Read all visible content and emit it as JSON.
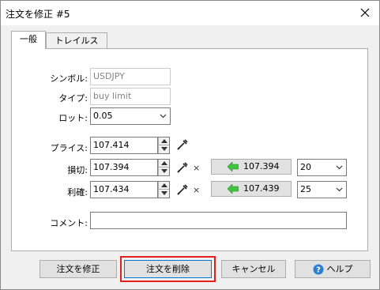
{
  "window": {
    "title": "注文を修正 #5",
    "close_icon": "close-icon"
  },
  "tabs": [
    {
      "label": "一般",
      "active": true
    },
    {
      "label": "トレイルストップ",
      "active": false
    }
  ],
  "form": {
    "symbol_label": "シンボル:",
    "symbol_value": "USDJPY",
    "type_label": "タイプ:",
    "type_value": "buy limit",
    "lot_label": "ロット:",
    "lot_value": "0.05",
    "price_label": "プライス:",
    "price_value": "107.414",
    "stoploss_label": "損切:",
    "stoploss_value": "107.394",
    "stoploss_market_value": "107.394",
    "stoploss_points": "20",
    "takeprofit_label": "利確:",
    "takeprofit_value": "107.434",
    "takeprofit_market_value": "107.439",
    "takeprofit_points": "25",
    "comment_label": "コメント:",
    "comment_value": "",
    "x_symbol": "×"
  },
  "buttons": {
    "modify_label": "注文を修正",
    "delete_label": "注文を削除",
    "cancel_label": "キャンセル",
    "help_label": "ヘルプ"
  },
  "colors": {
    "highlight": "#e01f1f",
    "arrow_green": "#3ec43e",
    "help_blue": "#2a7fd4"
  }
}
